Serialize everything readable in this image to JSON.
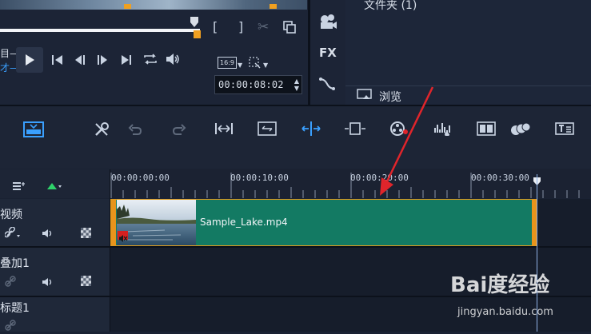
{
  "library": {
    "folder_label": "文件夹 (1)",
    "browse_label": "浏览",
    "side_icons": [
      "media-icon",
      "fx-icon",
      "transition-icon"
    ],
    "fx_label": "FX"
  },
  "player": {
    "left_label_1": "目—",
    "left_label_2": "才—",
    "aspect_label": "16:9",
    "timecode": "00:00:08:02"
  },
  "ruler": {
    "ticks": [
      "00:00:00:00",
      "00:00:10:00",
      "00:00:20:00",
      "00:00:30:00"
    ]
  },
  "tracks": [
    {
      "name": "视频"
    },
    {
      "name": "叠加1"
    },
    {
      "name": "标题1"
    }
  ],
  "clip": {
    "filename": "Sample_Lake.mp4"
  },
  "watermark": {
    "brand": "Bai度经验",
    "url": "jingyan.baidu.com"
  },
  "colors": {
    "accent": "#3aa0ff",
    "clip": "#137a63",
    "clip_border": "#d99a20",
    "arrow": "#e0252b"
  }
}
